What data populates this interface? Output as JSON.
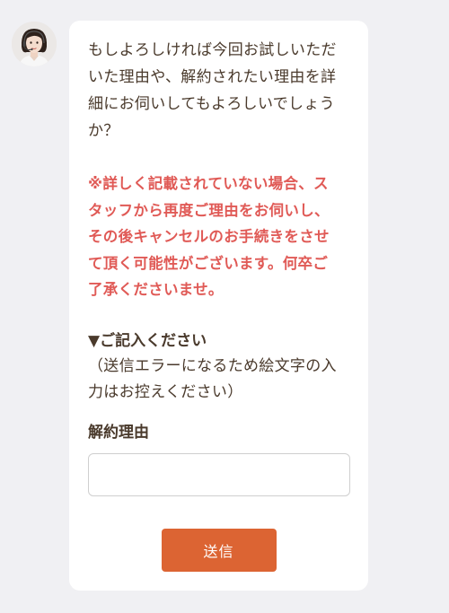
{
  "chat": {
    "avatar_icon": "operator-woman-headset-avatar",
    "message_lines": [
      "もしよろしければ今回お試しいただ",
      "いた理由や、解約されたい理由を詳",
      "細にお伺いしてもよろしいでしょう",
      "か？"
    ],
    "warning_lines": [
      "※詳しく記載されていない場合、ス",
      "タッフから再度ご理由をお伺いし、",
      "その後キャンセルのお手続きをさせ",
      "て頂く可能性がございます。何卒ご",
      "了承くださいませ。"
    ],
    "instruction_head": "▼ご記入ください",
    "instruction_note_lines": [
      "（送信エラーになるため絵文字の入",
      "力はお控えください）"
    ]
  },
  "form": {
    "label": "解約理由",
    "value": "",
    "placeholder": "",
    "submit_label": "送信"
  },
  "colors": {
    "page_bg": "#f0f0f3",
    "card_bg": "#ffffff",
    "text": "#4a3a2c",
    "warning": "#e05a56",
    "button": "#dc6433"
  }
}
